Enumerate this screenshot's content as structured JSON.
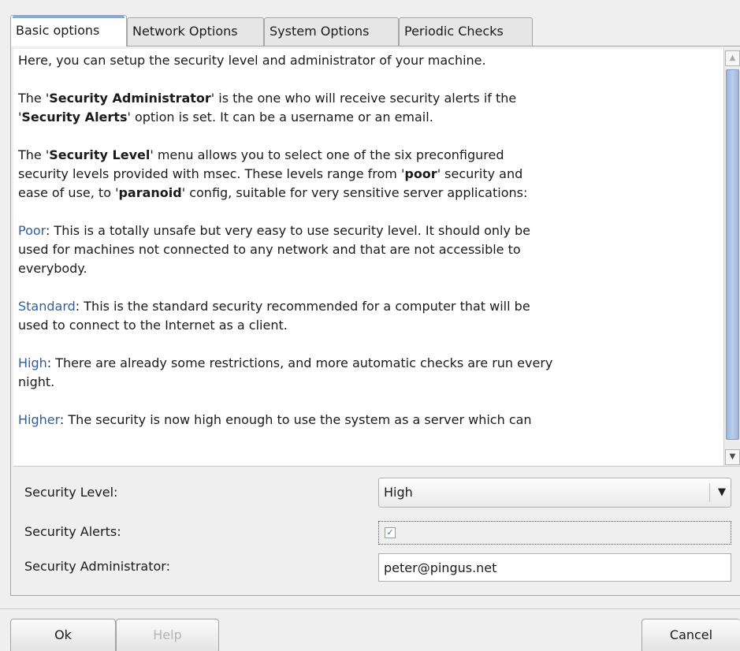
{
  "tabs": [
    {
      "label": "Basic options",
      "active": true
    },
    {
      "label": "Network Options",
      "active": false
    },
    {
      "label": "System Options",
      "active": false
    },
    {
      "label": "Periodic Checks",
      "active": false
    }
  ],
  "help": {
    "intro": "Here, you can setup the security level and administrator of your machine.",
    "admin": {
      "t1": "The '",
      "b1": "Security Administrator",
      "t2": "' is the one who will receive security alerts if the",
      "t3": "'",
      "b2": "Security Alerts",
      "t4": "' option is set. It can be a username or an email."
    },
    "level": {
      "t1": "The '",
      "b1": "Security Level",
      "t2": "' menu allows you to select one of the six preconfigured",
      "t3": "security levels provided with msec. These levels range from '",
      "b2": "poor",
      "t4": "' security and",
      "t5": "ease of use, to '",
      "b3": "paranoid",
      "t6": "' config, suitable for very sensitive server applications:"
    },
    "poor": {
      "name": "Poor",
      "l1": ": This is a totally unsafe but very easy to use security level. It should only be",
      "l2": "used for machines not connected to any network and that are not accessible to",
      "l3": "everybody."
    },
    "standard": {
      "name": "Standard",
      "l1": ": This is the standard security recommended for a computer that will be",
      "l2": "used to connect to the Internet as a client."
    },
    "high": {
      "name": "High",
      "l1": ": There are already some restrictions, and more automatic checks are run every",
      "l2": "night."
    },
    "higher": {
      "name": "Higher",
      "l1": ": The security is now high enough to use the system as a server which can"
    }
  },
  "form": {
    "security_level_label": "Security Level:",
    "security_level_value": "High",
    "security_alerts_label": "Security Alerts:",
    "security_alerts_checked": true,
    "security_admin_label": "Security Administrator:",
    "security_admin_value": "peter@pingus.net"
  },
  "buttons": {
    "ok": "Ok",
    "help": "Help",
    "cancel": "Cancel"
  },
  "colors": {
    "level_name": "#2c5ea8",
    "tab_highlight": "#88a8d8",
    "scroll_thumb": "#9db5de"
  }
}
